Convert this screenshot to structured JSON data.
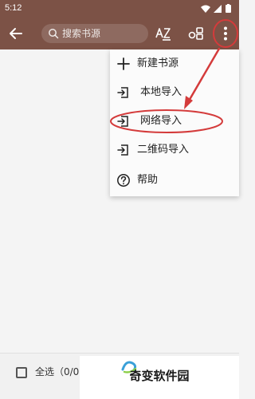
{
  "status_bar": {
    "time": "5:12"
  },
  "app_bar": {
    "back_icon": "arrow-left-icon",
    "search": {
      "placeholder": "搜索书源"
    },
    "sort_icon": "az-sort-icon",
    "group_icon": "group-icon",
    "more_icon": "more-vertical-icon"
  },
  "menu": {
    "items": [
      {
        "label": "新建书源",
        "icon": "plus-icon"
      },
      {
        "label": "本地导入",
        "icon": "import-icon"
      },
      {
        "label": "网络导入",
        "icon": "import-icon"
      },
      {
        "label": "二维码导入",
        "icon": "import-icon"
      },
      {
        "label": "帮助",
        "icon": "help-icon"
      }
    ]
  },
  "bottom_bar": {
    "select_all_label": "全选（0/0）"
  },
  "watermark": {
    "text": "奇变软件园"
  },
  "colors": {
    "app_bar": "#7c5246",
    "annotation": "#d43b3b"
  }
}
